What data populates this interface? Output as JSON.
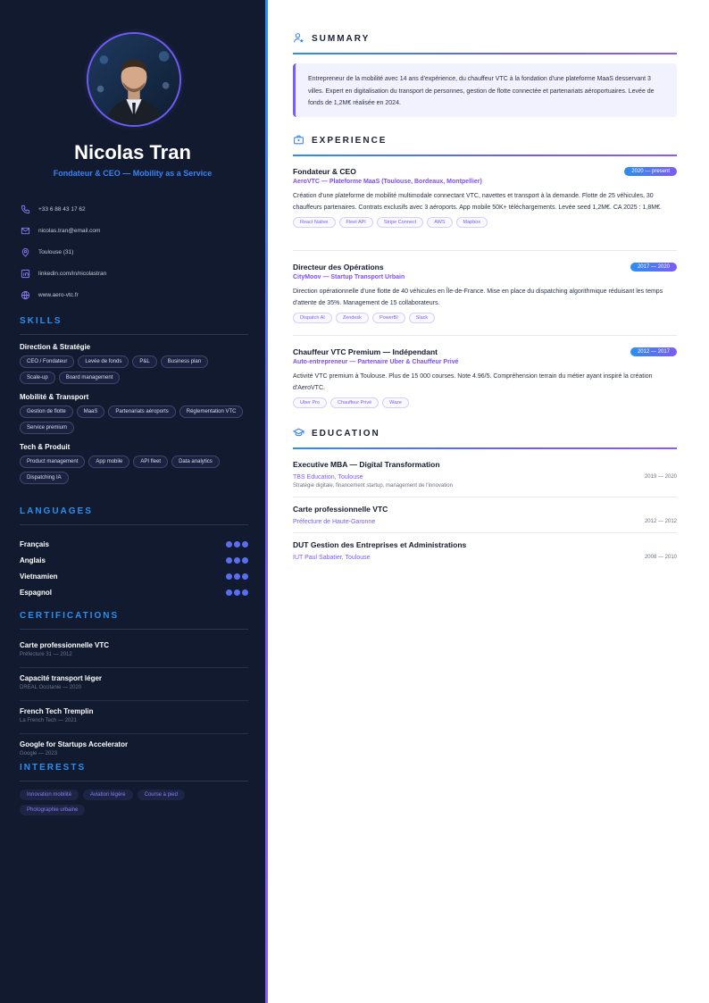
{
  "profile": {
    "name": "Nicolas Tran",
    "role": "Fondateur & CEO — Mobility as a Service"
  },
  "contacts": [
    {
      "icon": "phone-icon",
      "text": "+33 6 88 43 17 62"
    },
    {
      "icon": "mail-icon",
      "text": "nicolas.tran@email.com"
    },
    {
      "icon": "location-pin-icon",
      "text": "Toulouse (31)"
    },
    {
      "icon": "linkedin-icon",
      "text": "linkedin.com/in/nicolastran"
    },
    {
      "icon": "globe-icon",
      "text": "www.aero-vtc.fr"
    }
  ],
  "skills": {
    "heading": "SKILLS",
    "groups": [
      {
        "title": "Direction & Stratégie",
        "items": [
          "CEO / Fondateur",
          "Levée de fonds",
          "P&L",
          "Business plan",
          "Scale-up",
          "Board management"
        ]
      },
      {
        "title": "Mobilité & Transport",
        "items": [
          "Gestion de flotte",
          "MaaS",
          "Partenariats aéroports",
          "Réglementation VTC",
          "Service premium"
        ]
      },
      {
        "title": "Tech & Produit",
        "items": [
          "Product management",
          "App mobile",
          "API fleet",
          "Data analytics",
          "Dispatching IA"
        ]
      }
    ]
  },
  "languages": {
    "heading": "LANGUAGES",
    "items": [
      {
        "name": "Français",
        "level": 3
      },
      {
        "name": "Anglais",
        "level": 3
      },
      {
        "name": "Vietnamien",
        "level": 3
      },
      {
        "name": "Espagnol",
        "level": 3
      }
    ]
  },
  "certifications": {
    "heading": "CERTIFICATIONS",
    "items": [
      {
        "title": "Carte professionnelle VTC",
        "sub": "Préfecture 31 — 2012"
      },
      {
        "title": "Capacité transport léger",
        "sub": "DREAL Occitanie — 2020"
      },
      {
        "title": "French Tech Tremplin",
        "sub": "La French Tech — 2021"
      },
      {
        "title": "Google for Startups Accelerator",
        "sub": "Google — 2023"
      }
    ]
  },
  "interests": {
    "heading": "INTERESTS",
    "items": [
      "Innovation mobilité",
      "Aviation légère",
      "Course à pied",
      "Photographie urbaine"
    ]
  },
  "summary": {
    "heading": "SUMMARY",
    "text": "Entrepreneur de la mobilité avec 14 ans d'expérience, du chauffeur VTC à la fondation d'une plateforme MaaS desservant 3 villes. Expert en digitalisation du transport de personnes, gestion de flotte connectée et partenariats aéroportuaires. Levée de fonds de 1,2M€ réalisée en 2024."
  },
  "experience": {
    "heading": "EXPERIENCE",
    "items": [
      {
        "title": "Fondateur & CEO",
        "dates": "2020 — present",
        "company": "AeroVTC — Plateforme MaaS (Toulouse, Bordeaux, Montpellier)",
        "desc": "Création d'une plateforme de mobilité multimodale connectant VTC, navettes et transport à la demande. Flotte de 25 véhicules, 30 chauffeurs partenaires. Contrats exclusifs avec 3 aéroports. App mobile 50K+ téléchargements. Levée seed 1,2M€. CA 2025 : 1,8M€.",
        "tags": [
          "React Native",
          "Fleet API",
          "Stripe Connect",
          "AWS",
          "Mapbox"
        ]
      },
      {
        "title": "Directeur des Opérations",
        "dates": "2017 — 2020",
        "company": "CityMoov — Startup Transport Urbain",
        "desc": "Direction opérationnelle d'une flotte de 40 véhicules en Île-de-France. Mise en place du dispatching algorithmique réduisant les temps d'attente de 35%. Management de 15 collaborateurs.",
        "tags": [
          "Dispatch AI",
          "Zendesk",
          "PowerBI",
          "Slack"
        ]
      },
      {
        "title": "Chauffeur VTC Premium — Indépendant",
        "dates": "2012 — 2017",
        "company": "Auto-entrepreneur — Partenaire Uber & Chauffeur Privé",
        "desc": "Activité VTC premium à Toulouse. Plus de 15 000 courses. Note 4.96/5. Compréhension terrain du métier ayant inspiré la création d'AeroVTC.",
        "tags": [
          "Uber Pro",
          "Chauffeur Privé",
          "Waze"
        ]
      }
    ]
  },
  "education": {
    "heading": "EDUCATION",
    "items": [
      {
        "title": "Executive MBA — Digital Transformation",
        "school": "TBS Education, Toulouse",
        "years": "2019 — 2020",
        "note": "Stratégie digitale, financement startup, management de l'innovation"
      },
      {
        "title": "Carte professionnelle VTC",
        "school": "Préfecture de Haute-Garonne",
        "years": "2012 — 2012",
        "note": ""
      },
      {
        "title": "DUT Gestion des Entreprises et Administrations",
        "school": "IUT Paul Sabatier, Toulouse",
        "years": "2008 — 2010",
        "note": ""
      }
    ]
  },
  "colors": {
    "sidebar_bg": "#121a2f",
    "accent_blue": "#2b8ff0",
    "accent_purple": "#7c5cf5"
  }
}
